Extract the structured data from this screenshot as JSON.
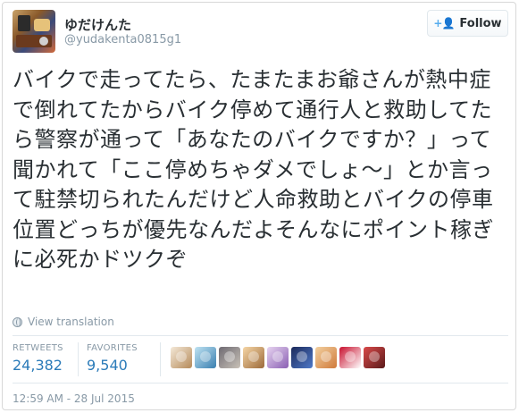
{
  "user": {
    "display_name": "ゆだけんた",
    "screen_name": "@yudakenta0815g1"
  },
  "follow_button": {
    "icon": "person-add-icon",
    "label": "Follow"
  },
  "tweet": {
    "text": "バイクで走ってたら、たまたまお爺さんが熱中症で倒れてたからバイク停めて通行人と救助してたら警察が通って「あなたのバイクですか？」って聞かれて「ここ停めちゃダメでしょ～」とか言って駐禁切られたんだけど人命救助とバイクの停車位置どっちが優先なんだよそんなにポイント稼ぎに必死かドツクぞ",
    "translate_label": "View translation"
  },
  "stats": {
    "retweets_label": "RETWEETS",
    "retweets": "24,382",
    "favorites_label": "FAVORITES",
    "favorites": "9,540"
  },
  "favoriter_avatars": [
    {
      "colors": [
        "#f4e9d8",
        "#b58a5a"
      ]
    },
    {
      "colors": [
        "#bfe3f2",
        "#3a7fb0"
      ]
    },
    {
      "colors": [
        "#6e6a72",
        "#c9c2b8"
      ]
    },
    {
      "colors": [
        "#f6d6a6",
        "#9c6a3a"
      ]
    },
    {
      "colors": [
        "#e7d4f0",
        "#8a5fb3"
      ]
    },
    {
      "colors": [
        "#1c2a5a",
        "#4e79c9"
      ]
    },
    {
      "colors": [
        "#f2d0a0",
        "#d07a3a"
      ]
    },
    {
      "colors": [
        "#c8102e",
        "#ffffff"
      ]
    },
    {
      "colors": [
        "#d94a4a",
        "#5a1a1a"
      ]
    }
  ],
  "timestamp": "12:59 AM - 28 Jul 2015"
}
